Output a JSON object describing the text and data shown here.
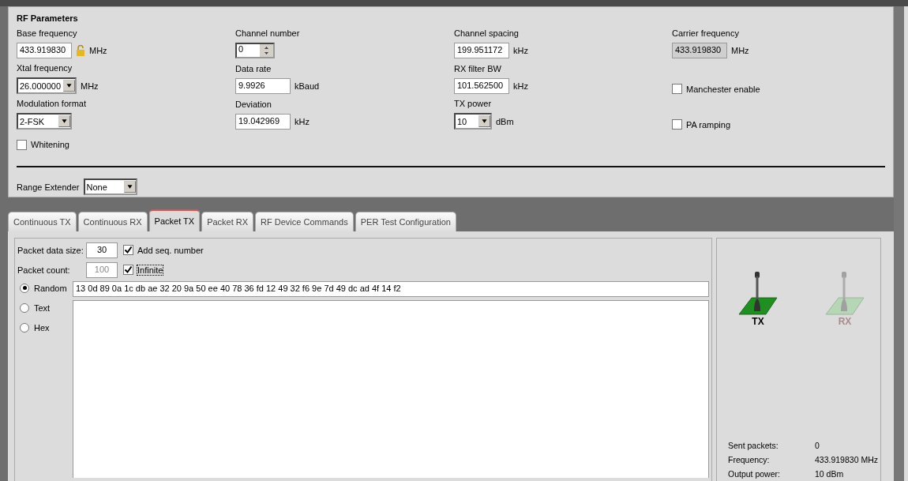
{
  "rf_parameters": {
    "title": "RF Parameters",
    "columns": [
      [
        {
          "kind": "field",
          "label": "Base frequency",
          "value": "433.919830",
          "unit": "MHz",
          "unlocked": true
        },
        {
          "kind": "dropdown",
          "label": "Xtal frequency",
          "value": "26.000000",
          "unit": "MHz"
        },
        {
          "kind": "dropdown",
          "label": "Modulation format",
          "value": "2-FSK"
        },
        {
          "kind": "checkbox",
          "label": "Whitening",
          "checked": false
        }
      ],
      [
        {
          "kind": "spin",
          "label": "Channel number",
          "value": "0"
        },
        {
          "kind": "field",
          "label": "Data rate",
          "value": "9.9926",
          "unit": "kBaud"
        },
        {
          "kind": "field",
          "label": "Deviation",
          "value": "19.042969",
          "unit": "kHz"
        }
      ],
      [
        {
          "kind": "field",
          "label": "Channel spacing",
          "value": "199.951172",
          "unit": "kHz"
        },
        {
          "kind": "field",
          "label": "RX filter BW",
          "value": "101.562500",
          "unit": "kHz"
        },
        {
          "kind": "dropdown",
          "label": "TX power",
          "value": "10",
          "unit": "dBm"
        }
      ],
      [
        {
          "kind": "readonly",
          "label": "Carrier frequency",
          "value": "433.919830",
          "unit": "MHz"
        },
        {
          "kind": "checkbox",
          "label": "Manchester enable",
          "checked": false
        },
        {
          "kind": "checkbox",
          "label": "PA ramping",
          "checked": false
        }
      ]
    ],
    "range_extender": {
      "label": "Range Extender",
      "value": "None"
    }
  },
  "tabs": [
    {
      "label": "Continuous TX",
      "selected": false
    },
    {
      "label": "Continuous RX",
      "selected": false
    },
    {
      "label": "Packet TX",
      "selected": true
    },
    {
      "label": "Packet RX",
      "selected": false
    },
    {
      "label": "RF Device Commands",
      "selected": false
    },
    {
      "label": "PER Test Configuration",
      "selected": false
    }
  ],
  "packet_tx": {
    "settings": [
      {
        "label": "Packet data size:",
        "value": "30",
        "disabled": false,
        "option": {
          "label": "Add seq. number",
          "checked": true
        }
      },
      {
        "label": "Packet count:",
        "value": "100",
        "disabled": true,
        "option": {
          "label": "Infinite",
          "checked": true
        }
      }
    ],
    "payload_types": [
      {
        "label": "Random",
        "selected": true
      },
      {
        "label": "Text",
        "selected": false
      },
      {
        "label": "Hex",
        "selected": false
      }
    ],
    "random_data": "13 0d 89 0a 1c db ae 32 20 9a 50 ee 40 78 36 fd 12 49 32 f6 9e 7d 49 dc ad 4f 14 f2"
  },
  "status": {
    "indicators": [
      {
        "label": "TX",
        "active": true
      },
      {
        "label": "RX",
        "active": false
      }
    ],
    "stats": [
      {
        "label": "Sent packets:",
        "value": "0"
      },
      {
        "label": "Frequency:",
        "value": "433.919830 MHz"
      },
      {
        "label": "Output power:",
        "value": "10 dBm"
      }
    ]
  }
}
